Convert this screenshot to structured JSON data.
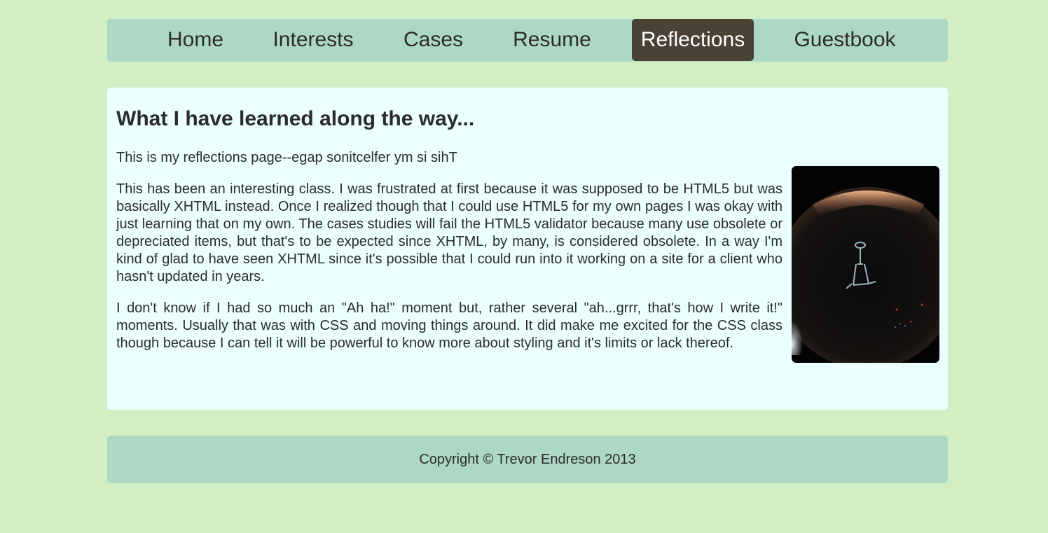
{
  "nav": {
    "items": [
      {
        "label": "Home",
        "active": false
      },
      {
        "label": "Interests",
        "active": false
      },
      {
        "label": "Cases",
        "active": false
      },
      {
        "label": "Resume",
        "active": false
      },
      {
        "label": "Reflections",
        "active": true
      },
      {
        "label": "Guestbook",
        "active": false
      }
    ]
  },
  "main": {
    "heading": "What I have learned along the way...",
    "intro": "This is my reflections page--egap sonitcelfer ym si sihT",
    "paragraphs": [
      "This has been an interesting class. I was frustrated at first because it was supposed to be HTML5 but was basically XHTML instead. Once I realized though that I could use HTML5 for my own pages I was okay with just learning that on my own. The cases studies will fail the HTML5 validator because many use obsolete or depreciated items, but that's to be expected since XHTML, by many, is considered obsolete. In a way I'm kind of glad to have seen XHTML since it's possible that I could run into it working on a site for a client who hasn't updated in years.",
      "I don't know if I had so much an \"Ah ha!\" moment but, rather several \"ah...grrr, that's how I write it!\" moments. Usually that was with CSS and moving things around. It did make me excited for the CSS class though because I can tell it will be powerful to know more about styling and it's limits or lack thereof."
    ]
  },
  "footer": {
    "copyright": "Copyright © Trevor Endreson 2013"
  },
  "colors": {
    "page_background": "#d2eec3",
    "bar_background": "#add8c5",
    "content_background": "#ebffff",
    "active_tab": "#4b4235",
    "text": "#2b2b2b"
  }
}
